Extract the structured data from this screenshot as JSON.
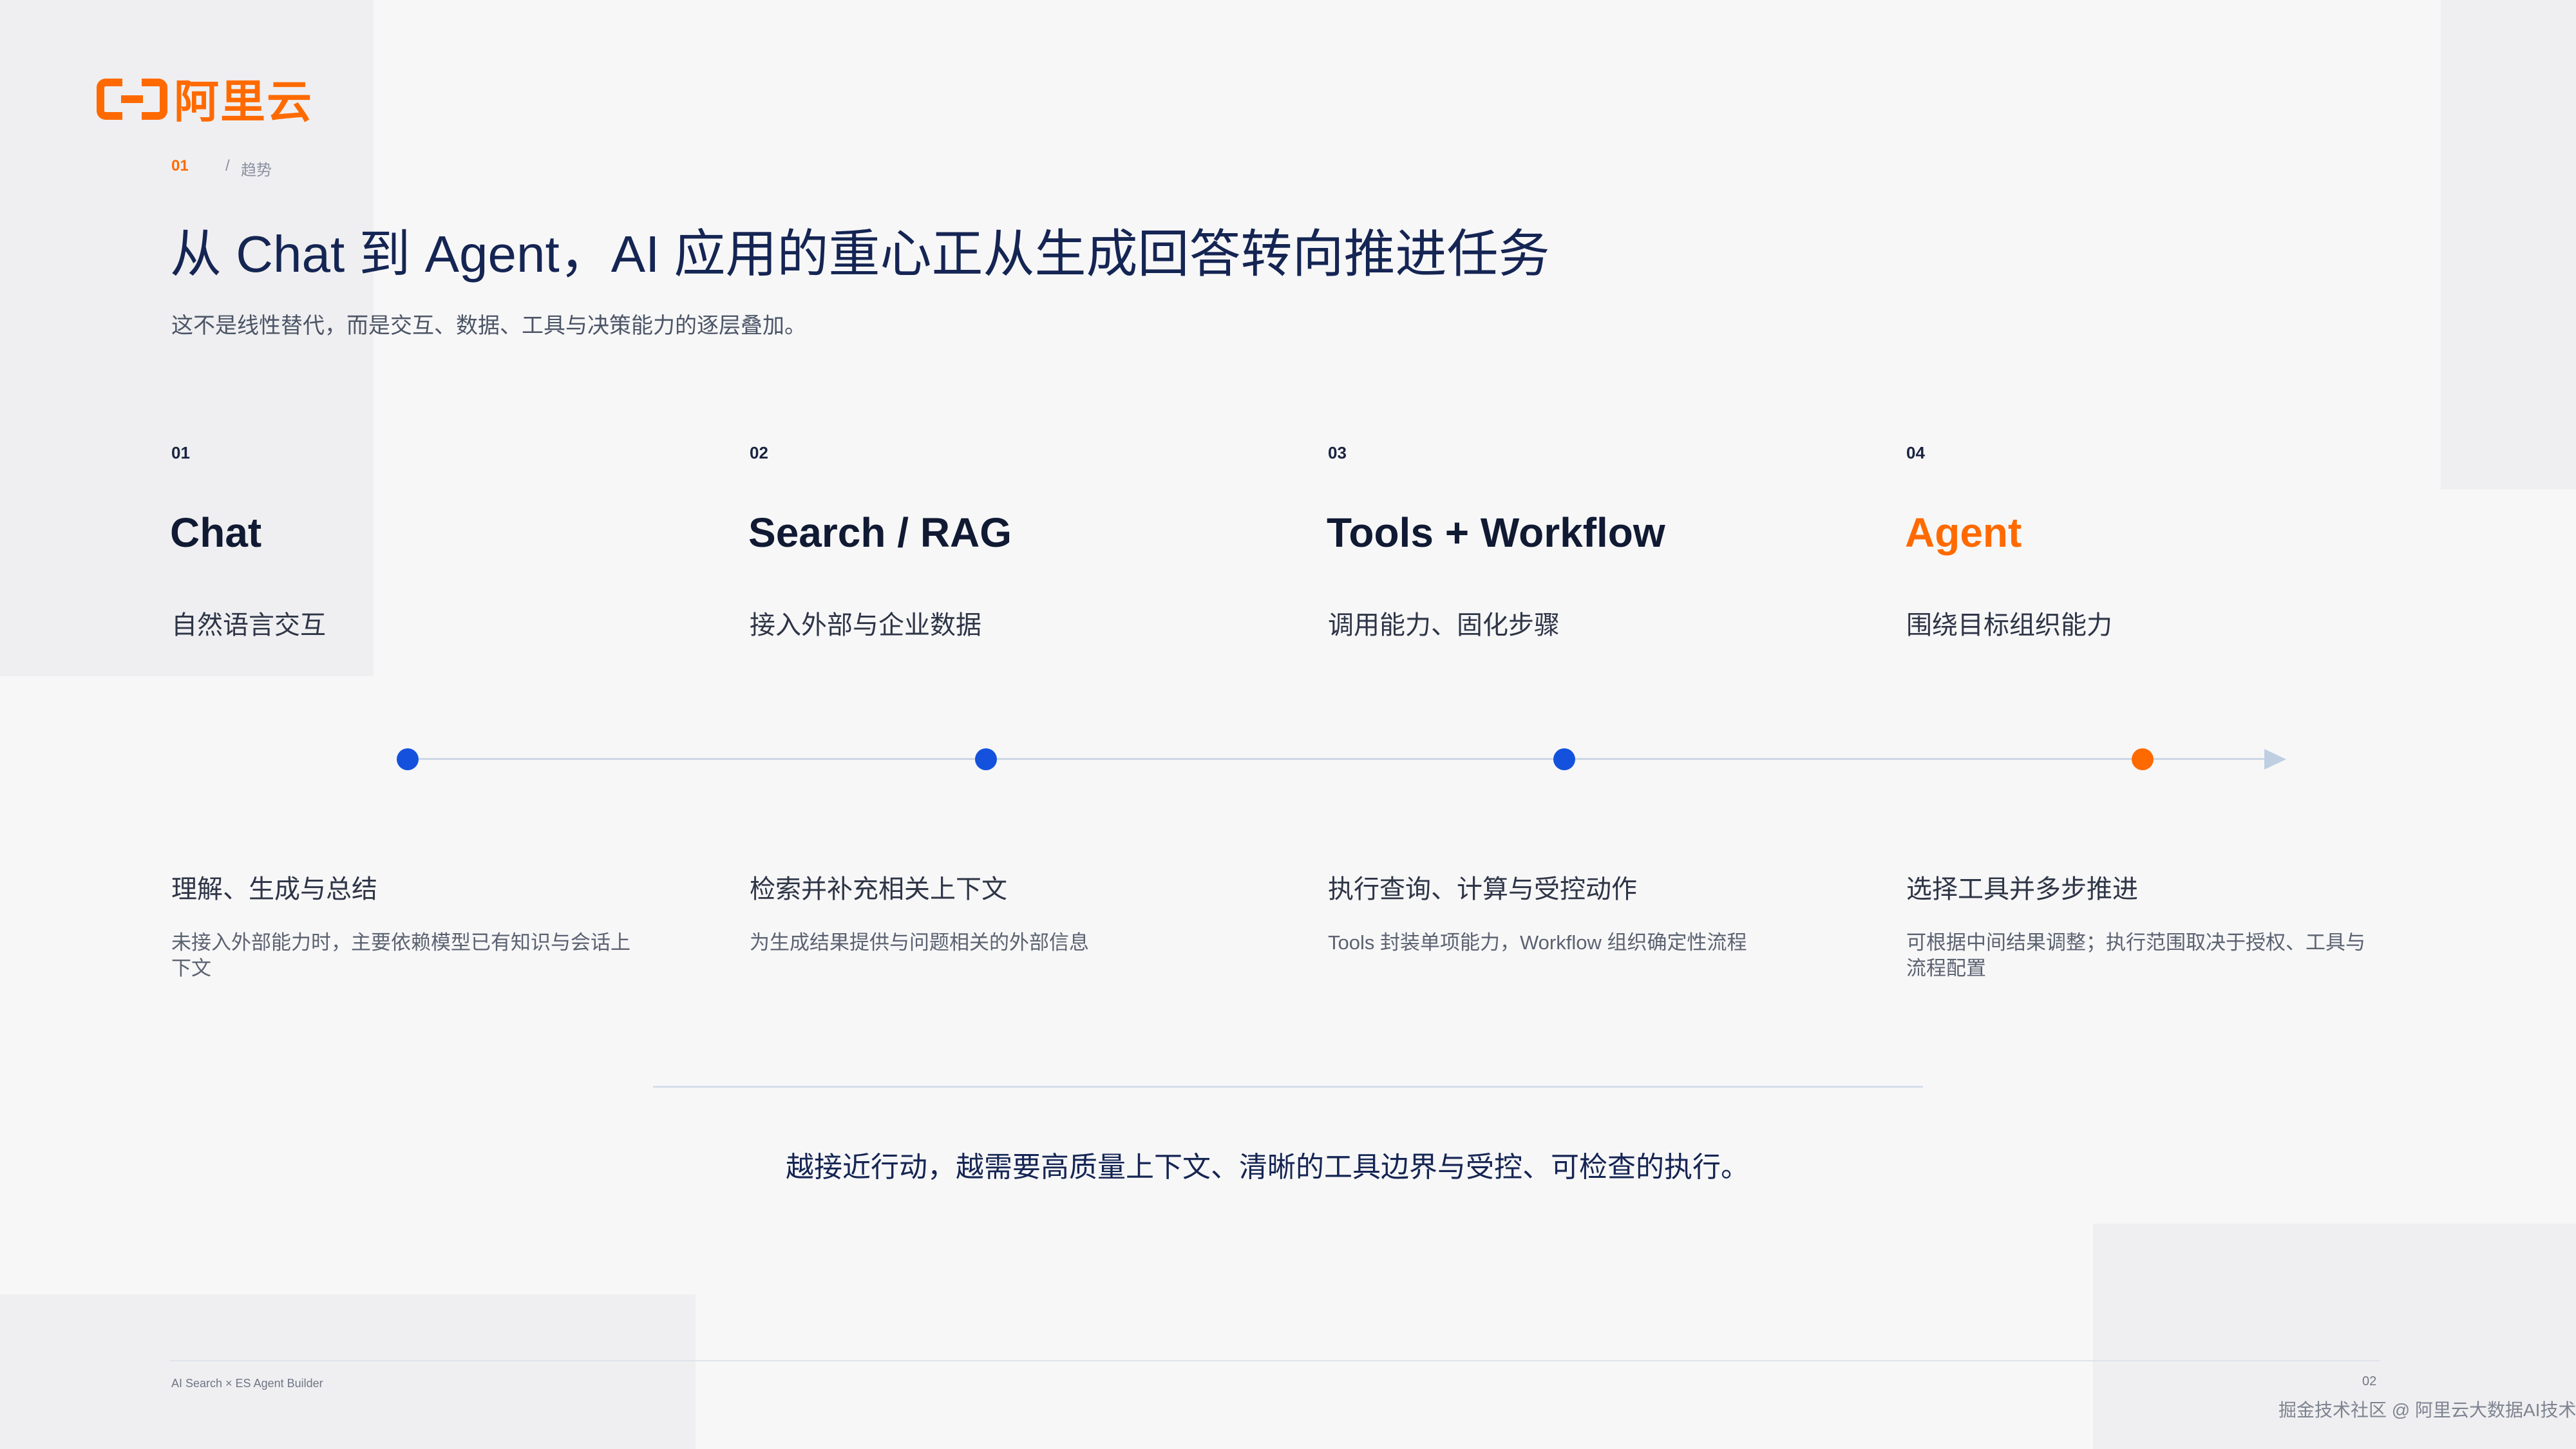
{
  "brand": {
    "logo_text": "阿里云",
    "accent": "#ff6a00",
    "blue": "#1452dd"
  },
  "breadcrumb": {
    "number": "01",
    "separator": "/",
    "label": "趋势"
  },
  "title": "从 Chat 到 Agent，AI 应用的重心正从生成回答转向推进任务",
  "subtitle": "这不是线性替代，而是交互、数据、工具与决策能力的逐层叠加。",
  "steps": [
    {
      "num": "01",
      "title": "Chat",
      "desc": "自然语言交互",
      "head": "理解、生成与总结",
      "text": "未接入外部能力时，主要依赖模型已有知识与会话上下文"
    },
    {
      "num": "02",
      "title": "Search / RAG",
      "desc": "接入外部与企业数据",
      "head": "检索并补充相关上下文",
      "text": "为生成结果提供与问题相关的外部信息"
    },
    {
      "num": "03",
      "title": "Tools + Workflow",
      "desc": "调用能力、固化步骤",
      "head": "执行查询、计算与受控动作",
      "text": "Tools 封装单项能力，Workflow 组织确定性流程"
    },
    {
      "num": "04",
      "title": "Agent",
      "desc": "围绕目标组织能力",
      "head": "选择工具并多步推进",
      "text": "可根据中间结果调整；执行范围取决于授权、工具与流程配置"
    }
  ],
  "summary": "越接近行动，越需要高质量上下文、清晰的工具边界与受控、可检查的执行。",
  "footer": {
    "left": "AI Search × ES Agent Builder",
    "page": "02",
    "watermark": "掘金技术社区 @ 阿里云大数据AI技术"
  }
}
